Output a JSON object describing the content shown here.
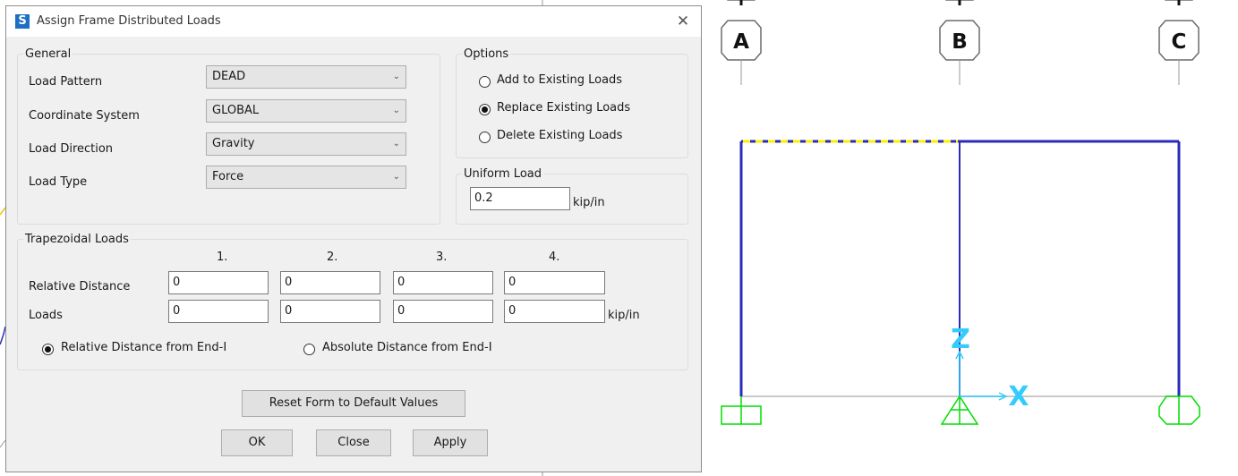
{
  "dialog": {
    "title": "Assign Frame Distributed Loads",
    "app_icon_letter": "S",
    "close_glyph": "✕"
  },
  "general": {
    "legend": "General",
    "load_pattern": {
      "label": "Load Pattern",
      "value": "DEAD"
    },
    "coordinate_system": {
      "label": "Coordinate System",
      "value": "GLOBAL"
    },
    "load_direction": {
      "label": "Load Direction",
      "value": "Gravity"
    },
    "load_type": {
      "label": "Load Type",
      "value": "Force"
    }
  },
  "options": {
    "legend": "Options",
    "choices": [
      {
        "label": "Add to Existing Loads",
        "selected": false
      },
      {
        "label": "Replace Existing Loads",
        "selected": true
      },
      {
        "label": "Delete Existing Loads",
        "selected": false
      }
    ]
  },
  "uniform": {
    "legend": "Uniform Load",
    "value": "0.2",
    "unit": "kip/in"
  },
  "trapezoidal": {
    "legend": "Trapezoidal Loads",
    "columns": [
      "1.",
      "2.",
      "3.",
      "4."
    ],
    "relative_distance_label": "Relative Distance",
    "relative_distances": [
      "0",
      "0",
      "0",
      "0"
    ],
    "loads_label": "Loads",
    "loads": [
      "0",
      "0",
      "0",
      "0"
    ],
    "unit": "kip/in",
    "distance_modes": [
      {
        "label": "Relative Distance from End-I",
        "selected": true
      },
      {
        "label": "Absolute Distance from End-I",
        "selected": false
      }
    ]
  },
  "buttons": {
    "reset": "Reset Form to Default Values",
    "ok": "OK",
    "close": "Close",
    "apply": "Apply"
  },
  "model_view": {
    "grid_bubbles": [
      "A",
      "B",
      "C"
    ],
    "axis_z": "Z",
    "axis_x": "X",
    "colors": {
      "frame": "#2b2bb8",
      "grid_line": "#c8c8c8",
      "load_dashes": "#ffee00",
      "support": "#00dd00",
      "axis": "#33ccff"
    }
  }
}
